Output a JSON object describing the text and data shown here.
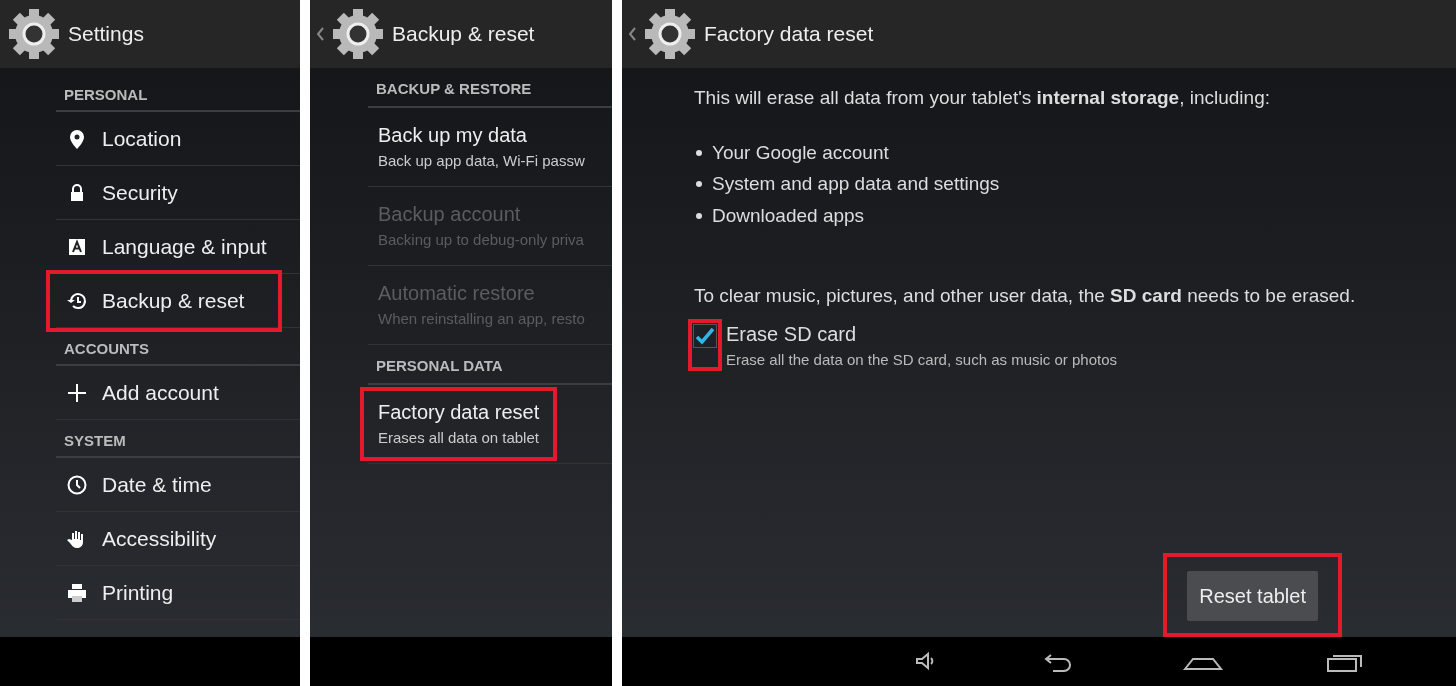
{
  "settings_panel": {
    "title": "Settings",
    "sections": [
      {
        "header": "PERSONAL",
        "items": [
          {
            "label": "Location",
            "kind": "location",
            "highlighted": false
          },
          {
            "label": "Security",
            "kind": "lock",
            "highlighted": false
          },
          {
            "label": "Language & input",
            "kind": "keyboard",
            "highlighted": false
          },
          {
            "label": "Backup & reset",
            "kind": "history",
            "highlighted": true
          }
        ]
      },
      {
        "header": "ACCOUNTS",
        "items": [
          {
            "label": "Add account",
            "kind": "plus",
            "highlighted": false
          }
        ]
      },
      {
        "header": "SYSTEM",
        "items": [
          {
            "label": "Date & time",
            "kind": "clock",
            "highlighted": false
          },
          {
            "label": "Accessibility",
            "kind": "hand",
            "highlighted": false
          },
          {
            "label": "Printing",
            "kind": "printer",
            "highlighted": false
          }
        ]
      }
    ]
  },
  "backup_panel": {
    "title": "Backup & reset",
    "sections": [
      {
        "header": "BACKUP & RESTORE",
        "items": [
          {
            "title": "Back up my data",
            "summary": "Back up app data, Wi-Fi passw",
            "disabled": false,
            "highlighted": false
          },
          {
            "title": "Backup account",
            "summary": "Backing up to debug-only priva",
            "disabled": true,
            "highlighted": false
          },
          {
            "title": "Automatic restore",
            "summary": "When reinstalling an app, resto",
            "disabled": true,
            "highlighted": false
          }
        ]
      },
      {
        "header": "PERSONAL DATA",
        "items": [
          {
            "title": "Factory data reset",
            "summary": "Erases all data on tablet",
            "disabled": false,
            "highlighted": true
          }
        ]
      }
    ]
  },
  "reset_panel": {
    "title": "Factory data reset",
    "intro": "This will erase all data from your tablet's **internal storage**, including:",
    "bullets": [
      "Your Google account",
      "System and app data and settings",
      "Downloaded apps"
    ],
    "sd_note": "To clear music, pictures, and other user data, the **SD card** needs to be erased.",
    "checkbox": {
      "label": "Erase SD card",
      "description": "Erase all the data on the SD card, such as music or photos",
      "checked": true,
      "highlighted": true
    },
    "button": {
      "label": "Reset tablet",
      "highlighted": true
    }
  }
}
